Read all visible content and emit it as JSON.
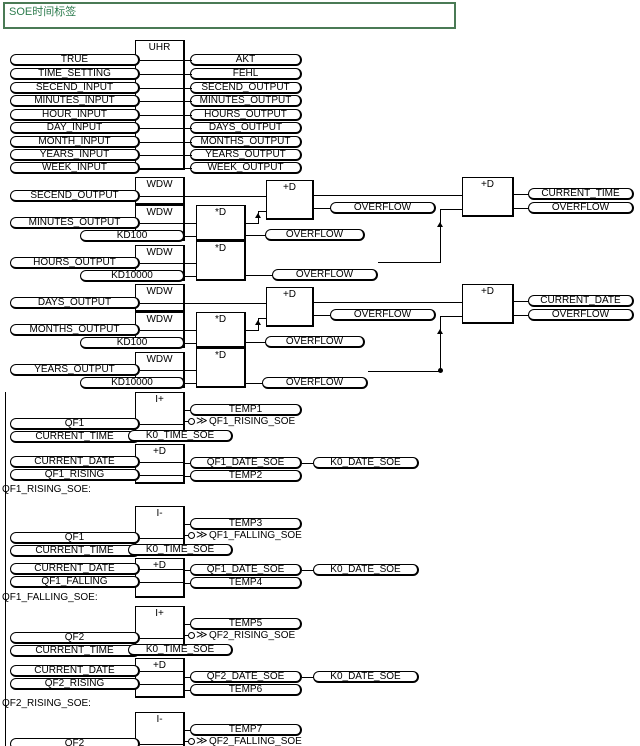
{
  "document": {
    "title_comment": "SOE时间标签",
    "accent_color": "#2e7d4f",
    "border_color": "#4a7a55",
    "wire_color": "#000000",
    "background": "#ffffff"
  },
  "blocks": {
    "uhr": "UHR",
    "wdw": "WDW",
    "mul_d": "*D",
    "add_d": "+D",
    "rising_edge": "I+",
    "falling_edge": "I-"
  },
  "clock_section": {
    "inputs": [
      "TRUE",
      "TIME_SETTING",
      "SECEND_INPUT",
      "MINUTES_INPUT",
      "HOUR_INPUT",
      "DAY_INPUT",
      "MONTH_INPUT",
      "YEARS_INPUT",
      "WEEK_INPUT"
    ],
    "outputs": [
      "AKT",
      "FEHL",
      "SECEND_OUTPUT",
      "MINUTES_OUTPUT",
      "HOURS_OUTPUT",
      "DAYS_OUTPUT",
      "MONTHS_OUTPUT",
      "YEARS_OUTPUT",
      "WEEK_OUTPUT"
    ]
  },
  "time_calc": {
    "sources": [
      "SECEND_OUTPUT",
      "MINUTES_OUTPUT",
      "HOURS_OUTPUT"
    ],
    "constants": [
      "KD100",
      "KD10000"
    ],
    "overflow": "OVERFLOW",
    "result": "CURRENT_TIME"
  },
  "date_calc": {
    "sources": [
      "DAYS_OUTPUT",
      "MONTHS_OUTPUT",
      "YEARS_OUTPUT"
    ],
    "constants": [
      "KD100",
      "KD10000"
    ],
    "overflow": "OVERFLOW",
    "result": "CURRENT_DATE"
  },
  "soe_networks": [
    {
      "label": "QF1_RISING_SOE:",
      "edge_block": "I+",
      "signal": "QF1",
      "time_in": "CURRENT_TIME",
      "time_out": "K0_TIME_SOE",
      "temp_a": "TEMP1",
      "jump": "QF1_RISING_SOE",
      "date_in": "CURRENT_DATE",
      "edge_flag": "QF1_RISING",
      "date_out": "QF1_DATE_SOE",
      "date_store": "K0_DATE_SOE",
      "temp_b": "TEMP2"
    },
    {
      "label": "QF1_FALLING_SOE:",
      "edge_block": "I-",
      "signal": "QF1",
      "time_in": "CURRENT_TIME",
      "time_out": "K0_TIME_SOE",
      "temp_a": "TEMP3",
      "jump": "QF1_FALLING_SOE",
      "date_in": "CURRENT_DATE",
      "edge_flag": "QF1_FALLING",
      "date_out": "QF1_DATE_SOE",
      "date_store": "K0_DATE_SOE",
      "temp_b": "TEMP4"
    },
    {
      "label": "QF2_RISING_SOE:",
      "edge_block": "I+",
      "signal": "QF2",
      "time_in": "CURRENT_TIME",
      "time_out": "K0_TIME_SOE",
      "temp_a": "TEMP5",
      "jump": "QF2_RISING_SOE",
      "date_in": "CURRENT_DATE",
      "edge_flag": "QF2_RISING",
      "date_out": "QF2_DATE_SOE",
      "date_store": "K0_DATE_SOE",
      "temp_b": "TEMP6"
    },
    {
      "label": "",
      "edge_block": "I-",
      "signal": "QF2",
      "temp_a": "TEMP7",
      "jump": "QF2_FALLING_SOE"
    }
  ],
  "symbols": {
    "jump_chevron": "≫",
    "negation": "negation-circle"
  }
}
